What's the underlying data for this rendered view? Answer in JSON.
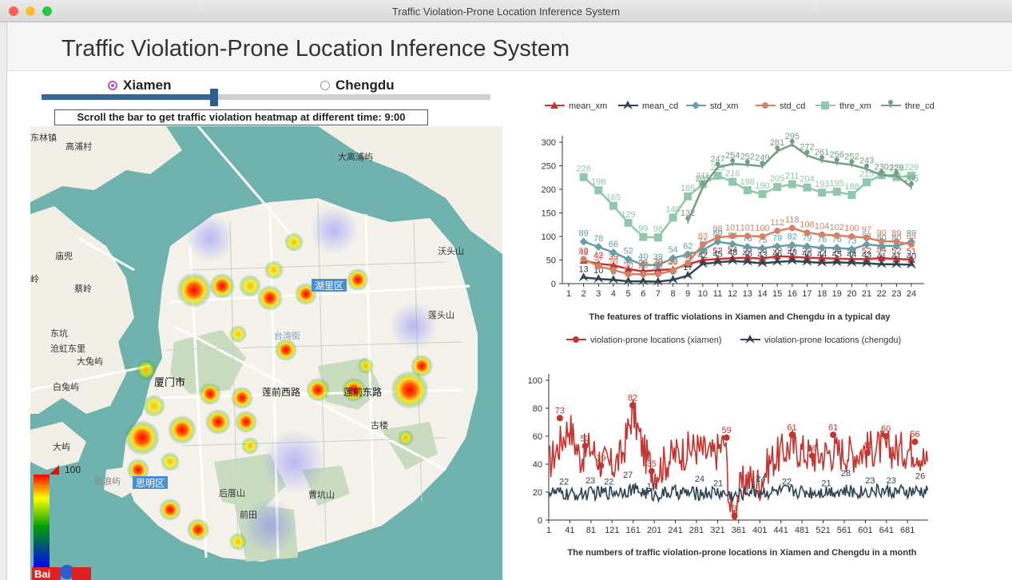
{
  "window": {
    "title": "Traffic Violation-Prone Location Inference System",
    "buttons": [
      "close",
      "minimize",
      "zoom"
    ],
    "colors": {
      "close": "#fe5f57",
      "minimize": "#febc2e",
      "zoom": "#28c840"
    }
  },
  "header": {
    "title": "Traffic Violation-Prone Location Inference System"
  },
  "city_selector": {
    "options": [
      {
        "label": "Xiamen",
        "selected": true
      },
      {
        "label": "Chengdu",
        "selected": false
      }
    ]
  },
  "time_slider": {
    "value_hour": 9,
    "min_hour": 1,
    "max_hour": 24
  },
  "slider_caption": "Scroll the bar to get traffic violation heatmap at different time: 9:00",
  "map": {
    "legend_max": "100",
    "legend_gradient": [
      "#ff0000",
      "#ffff00",
      "#00a000",
      "#0000ff"
    ],
    "watermark_logo": "Baidu map",
    "labels": {
      "l0": "东林镇",
      "l1": "高浦村",
      "l2": "大离浦屿",
      "l3": "沃头山",
      "l4": "庙兜",
      "l5": "蔡岭",
      "l6": "湖里区",
      "l7": "莲头山",
      "l8": "东坑",
      "l9": "沧虹东里",
      "l10": "大兔屿",
      "l11": "白兔屿",
      "l12": "台湾街",
      "l13": "厦门市",
      "l14": "莲前西路",
      "l15": "莲前东路",
      "l16": "古楼",
      "l17": "大屿",
      "l18": "鼓浪屿",
      "l19": "思明区",
      "l20": "后厝山",
      "l21": "曹坑山",
      "l22": "前田",
      "l23": "岭"
    }
  },
  "chart_data": [
    {
      "type": "line",
      "title": "The features of traffic violations in Xiamen and Chengdu in a typical day",
      "xlabel": "",
      "ylabel": "",
      "categories": [
        "1",
        "2",
        "3",
        "4",
        "5",
        "6",
        "7",
        "8",
        "9",
        "10",
        "11",
        "12",
        "13",
        "14",
        "15",
        "16",
        "17",
        "18",
        "19",
        "20",
        "21",
        "22",
        "23",
        "24"
      ],
      "ylim": [
        0,
        300
      ],
      "yticks": [
        "0",
        "50",
        "100",
        "150",
        "200",
        "250",
        "300"
      ],
      "legend_position": "top",
      "series": [
        {
          "name": "mean_xm",
          "color": "#c23531",
          "label_color": "#c23531",
          "marker": "triangle",
          "values": [
            null,
            49,
            42,
            39,
            31,
            26,
            29,
            30,
            41,
            50,
            52,
            54,
            55,
            53,
            58,
            57,
            55,
            54,
            53,
            52,
            52,
            54,
            52,
            51
          ]
        },
        {
          "name": "mean_cd",
          "color": "#2f4554",
          "label_color": "#2f4554",
          "marker": "arrow",
          "values": [
            null,
            13,
            10,
            8,
            5,
            5,
            4,
            8,
            17,
            42,
            45,
            48,
            46,
            43,
            46,
            48,
            46,
            44,
            45,
            44,
            43,
            41,
            41,
            40
          ]
        },
        {
          "name": "std_xm",
          "color": "#61a0a8",
          "label_color": "#61a0a8",
          "marker": "diamond",
          "values": [
            null,
            89,
            78,
            66,
            52,
            40,
            39,
            54,
            62,
            71,
            89,
            84,
            78,
            75,
            79,
            82,
            79,
            76,
            76,
            73,
            83,
            80,
            80,
            89
          ]
        },
        {
          "name": "std_cd",
          "color": "#d48265",
          "label_color": "#d48265",
          "marker": "circle",
          "values": [
            null,
            52,
            37,
            29,
            20,
            20,
            20,
            28,
            44,
            83,
            98,
            101,
            101,
            100,
            112,
            118,
            108,
            104,
            102,
            100,
            97,
            90,
            89,
            83
          ]
        },
        {
          "name": "thre_xm",
          "color": "#91c7ae",
          "label_color": "#91c7ae",
          "marker": "square",
          "values": [
            null,
            226,
            198,
            165,
            129,
            99,
            98,
            140,
            185,
            211,
            229,
            216,
            198,
            190,
            205,
            211,
            204,
            193,
            195,
            188,
            215,
            230,
            226,
            229
          ]
        },
        {
          "name": "thre_cd",
          "color": "#749f83",
          "label_color": "#749f83",
          "marker": "pin",
          "values": [
            null,
            null,
            null,
            null,
            null,
            null,
            null,
            null,
            132,
            205,
            247,
            254,
            252,
            249,
            281,
            295,
            272,
            261,
            256,
            252,
            243,
            230,
            229,
            205
          ]
        }
      ]
    },
    {
      "type": "line",
      "title": "The numbers of traffic violation-prone locations in Xiamen and Chengdu in a month",
      "xlabel": "",
      "ylabel": "",
      "x_tick_labels": [
        "1",
        "41",
        "81",
        "121",
        "161",
        "201",
        "241",
        "281",
        "321",
        "361",
        "401",
        "441",
        "481",
        "521",
        "561",
        "601",
        "641",
        "681"
      ],
      "x_range": [
        1,
        720
      ],
      "ylim": [
        0,
        100
      ],
      "yticks": [
        "0",
        "20",
        "40",
        "60",
        "80",
        "100"
      ],
      "legend_position": "top",
      "series": [
        {
          "name": "violation-prone locations (xiamen)",
          "color": "#c23531",
          "key_points": [
            [
              1,
              40
            ],
            [
              20,
              53
            ],
            [
              40,
              68
            ],
            [
              60,
              45
            ],
            [
              80,
              52
            ],
            [
              100,
              42
            ],
            [
              120,
              38
            ],
            [
              140,
              46
            ],
            [
              160,
              78
            ],
            [
              180,
              50
            ],
            [
              200,
              34
            ],
            [
              240,
              47
            ],
            [
              280,
              52
            ],
            [
              310,
              45
            ],
            [
              335,
              56
            ],
            [
              345,
              8
            ],
            [
              352,
              1
            ],
            [
              358,
              17
            ],
            [
              375,
              30
            ],
            [
              400,
              26
            ],
            [
              420,
              42
            ],
            [
              460,
              53
            ],
            [
              500,
              46
            ],
            [
              540,
              49
            ],
            [
              580,
              48
            ],
            [
              620,
              52
            ],
            [
              660,
              50
            ],
            [
              700,
              51
            ],
            [
              720,
              38
            ]
          ],
          "annotated_points": [
            [
              22,
              73
            ],
            [
              70,
              53
            ],
            [
              100,
              39
            ],
            [
              160,
              82
            ],
            [
              196,
              35
            ],
            [
              338,
              59
            ],
            [
              353,
              3
            ],
            [
              462,
              61
            ],
            [
              500,
              46
            ],
            [
              540,
              61
            ],
            [
              605,
              48
            ],
            [
              640,
              60
            ],
            [
              695,
              56
            ]
          ]
        },
        {
          "name": "violation-prone locations (chengdu)",
          "color": "#2f4554",
          "key_points": [
            [
              1,
              20
            ],
            [
              40,
              18
            ],
            [
              80,
              19
            ],
            [
              120,
              20
            ],
            [
              160,
              22
            ],
            [
              200,
              18
            ],
            [
              240,
              20
            ],
            [
              280,
              19
            ],
            [
              320,
              20
            ],
            [
              355,
              17
            ],
            [
              380,
              21
            ],
            [
              420,
              20
            ],
            [
              460,
              21
            ],
            [
              500,
              20
            ],
            [
              540,
              21
            ],
            [
              580,
              20
            ],
            [
              620,
              21
            ],
            [
              660,
              20
            ],
            [
              720,
              20
            ]
          ],
          "annotated_points": [
            [
              30,
              22
            ],
            [
              80,
              23
            ],
            [
              115,
              22
            ],
            [
              151,
              27
            ],
            [
              196,
              19
            ],
            [
              287,
              24
            ],
            [
              322,
              21
            ],
            [
              403,
              24
            ],
            [
              452,
              22
            ],
            [
              527,
              21
            ],
            [
              564,
              28
            ],
            [
              610,
              23
            ],
            [
              650,
              23
            ],
            [
              705,
              26
            ]
          ]
        }
      ]
    }
  ]
}
